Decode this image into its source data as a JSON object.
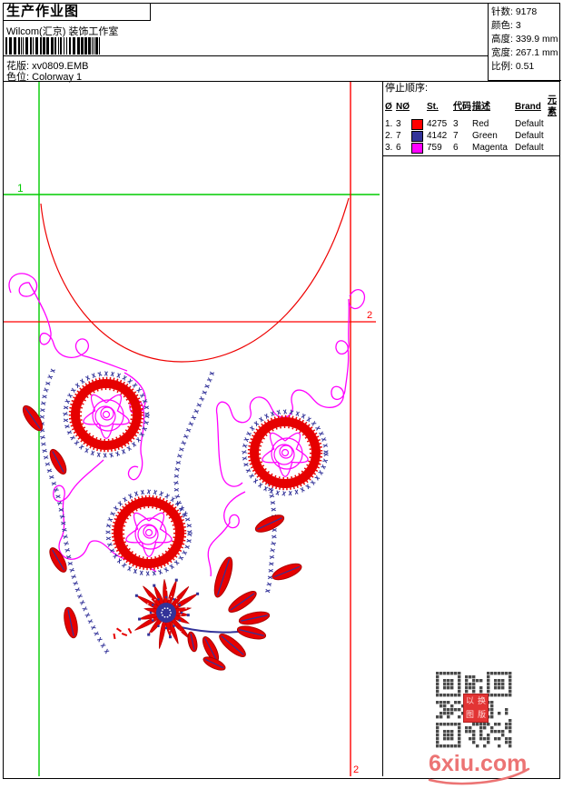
{
  "header": {
    "title": "生产作业图",
    "subtitle": "Wilcom(汇京) 装饰工作室",
    "pattern_label": "花版:",
    "pattern_value": "xv0809.EMB",
    "colorway_label": "色位:",
    "colorway_value": "Colorway 1"
  },
  "stats": {
    "rows": [
      {
        "label": "针数:",
        "value": "9178"
      },
      {
        "label": "颜色:",
        "value": "3"
      },
      {
        "label": "高度:",
        "value": "339.9 mm"
      },
      {
        "label": "宽度:",
        "value": "267.1 mm"
      },
      {
        "label": "比例:",
        "value": "0.51"
      }
    ]
  },
  "sequence": {
    "title": "停止顺序:",
    "columns": [
      "Ø",
      "NØ",
      "",
      "St.",
      "代码",
      "描述",
      "Brand",
      "元素"
    ],
    "rows": [
      {
        "idx": "1.",
        "n": "3",
        "color": "#ff0000",
        "st": "4275",
        "code": "3",
        "desc": "Red",
        "brand": "Default",
        "element": ""
      },
      {
        "idx": "2.",
        "n": "7",
        "color": "#333399",
        "st": "4142",
        "code": "7",
        "desc": "Green",
        "brand": "Default",
        "element": ""
      },
      {
        "idx": "3.",
        "n": "6",
        "color": "#ff00ff",
        "st": "759",
        "code": "6",
        "desc": "Magenta",
        "brand": "Default",
        "element": ""
      }
    ]
  },
  "guides": {
    "label1": "1",
    "label2_mid": "2",
    "label2_bottom": "2"
  },
  "watermark": {
    "text": "6xiu.com",
    "stamp_chars": [
      "以",
      "换",
      "图",
      "版"
    ]
  },
  "colors": {
    "guide_green": "#00cc00",
    "guide_red": "#ff0000",
    "stitch_blue": "#333399",
    "stitch_red": "#e60000",
    "stitch_magenta": "#ff00ff"
  }
}
